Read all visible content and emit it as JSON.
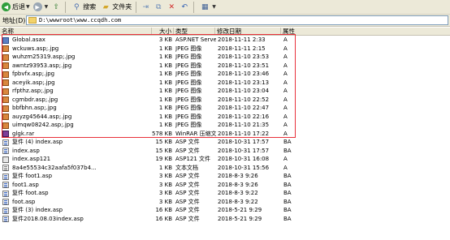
{
  "toolbar": {
    "back": "后退",
    "search": "搜索",
    "folders": "文件夹"
  },
  "address": {
    "label": "地址(D)",
    "path": "D:\\wwwroot\\www.ccqdh.com"
  },
  "columns": {
    "name": "名称",
    "size": "大小",
    "type": "类型",
    "modified": "修改日期",
    "attributes": "属性"
  },
  "highlight_color": "#e8303a",
  "files": [
    {
      "name": "Global.asax",
      "size": "3 KB",
      "type": "ASP.NET Server ...",
      "modified": "2018-11-11 2:33",
      "attr": "A",
      "icon": "aspx"
    },
    {
      "name": "wckuws.asp;.jpg",
      "size": "1 KB",
      "type": "JPEG 图像",
      "modified": "2018-11-11 2:15",
      "attr": "A",
      "icon": "jpg"
    },
    {
      "name": "wuhzm25319.asp;.jpg",
      "size": "1 KB",
      "type": "JPEG 图像",
      "modified": "2018-11-10 23:53",
      "attr": "A",
      "icon": "jpg"
    },
    {
      "name": "awntz93953.asp;.jpg",
      "size": "1 KB",
      "type": "JPEG 图像",
      "modified": "2018-11-10 23:51",
      "attr": "A",
      "icon": "jpg"
    },
    {
      "name": "fpbvfx.asp;.jpg",
      "size": "1 KB",
      "type": "JPEG 图像",
      "modified": "2018-11-10 23:46",
      "attr": "A",
      "icon": "jpg"
    },
    {
      "name": "aceyik.asp;.jpg",
      "size": "1 KB",
      "type": "JPEG 图像",
      "modified": "2018-11-10 23:13",
      "attr": "A",
      "icon": "jpg"
    },
    {
      "name": "rfpthz.asp;.jpg",
      "size": "1 KB",
      "type": "JPEG 图像",
      "modified": "2018-11-10 23:04",
      "attr": "A",
      "icon": "jpg"
    },
    {
      "name": "cgmbdr.asp;.jpg",
      "size": "1 KB",
      "type": "JPEG 图像",
      "modified": "2018-11-10 22:52",
      "attr": "A",
      "icon": "jpg"
    },
    {
      "name": "bbfbhn.asp;.jpg",
      "size": "1 KB",
      "type": "JPEG 图像",
      "modified": "2018-11-10 22:47",
      "attr": "A",
      "icon": "jpg"
    },
    {
      "name": "auyzg45644.asp;.jpg",
      "size": "1 KB",
      "type": "JPEG 图像",
      "modified": "2018-11-10 22:16",
      "attr": "A",
      "icon": "jpg"
    },
    {
      "name": "uimqw08242.asp;.jpg",
      "size": "1 KB",
      "type": "JPEG 图像",
      "modified": "2018-11-10 21:35",
      "attr": "A",
      "icon": "jpg"
    },
    {
      "name": "glgk.rar",
      "size": "578 KB",
      "type": "WinRAR 压缩文件",
      "modified": "2018-11-10 17:22",
      "attr": "A",
      "icon": "rar"
    },
    {
      "name": "复件 (4) index.asp",
      "size": "15 KB",
      "type": "ASP 文件",
      "modified": "2018-10-31 17:57",
      "attr": "BA",
      "icon": "asp"
    },
    {
      "name": "index.asp",
      "size": "15 KB",
      "type": "ASP 文件",
      "modified": "2018-10-31 17:57",
      "attr": "BA",
      "icon": "asp"
    },
    {
      "name": "index.asp121",
      "size": "19 KB",
      "type": "ASP121 文件",
      "modified": "2018-10-31 16:08",
      "attr": "A",
      "icon": "asp121"
    },
    {
      "name": "8a4e55534c32aafa5f037b4...",
      "size": "1 KB",
      "type": "文本文档",
      "modified": "2018-10-31 15:56",
      "attr": "A",
      "icon": "txt"
    },
    {
      "name": "复件 foot1.asp",
      "size": "3 KB",
      "type": "ASP 文件",
      "modified": "2018-8-3 9:26",
      "attr": "BA",
      "icon": "asp"
    },
    {
      "name": "foot1.asp",
      "size": "3 KB",
      "type": "ASP 文件",
      "modified": "2018-8-3 9:26",
      "attr": "BA",
      "icon": "asp"
    },
    {
      "name": "复件 foot.asp",
      "size": "3 KB",
      "type": "ASP 文件",
      "modified": "2018-8-3 9:22",
      "attr": "BA",
      "icon": "asp"
    },
    {
      "name": "foot.asp",
      "size": "3 KB",
      "type": "ASP 文件",
      "modified": "2018-8-3 9:22",
      "attr": "BA",
      "icon": "asp"
    },
    {
      "name": "复件 (3) index.asp",
      "size": "16 KB",
      "type": "ASP 文件",
      "modified": "2018-5-21 9:29",
      "attr": "BA",
      "icon": "asp"
    },
    {
      "name": "复件2018.08.03index.asp",
      "size": "16 KB",
      "type": "ASP 文件",
      "modified": "2018-5-21 9:29",
      "attr": "BA",
      "icon": "asp"
    }
  ]
}
